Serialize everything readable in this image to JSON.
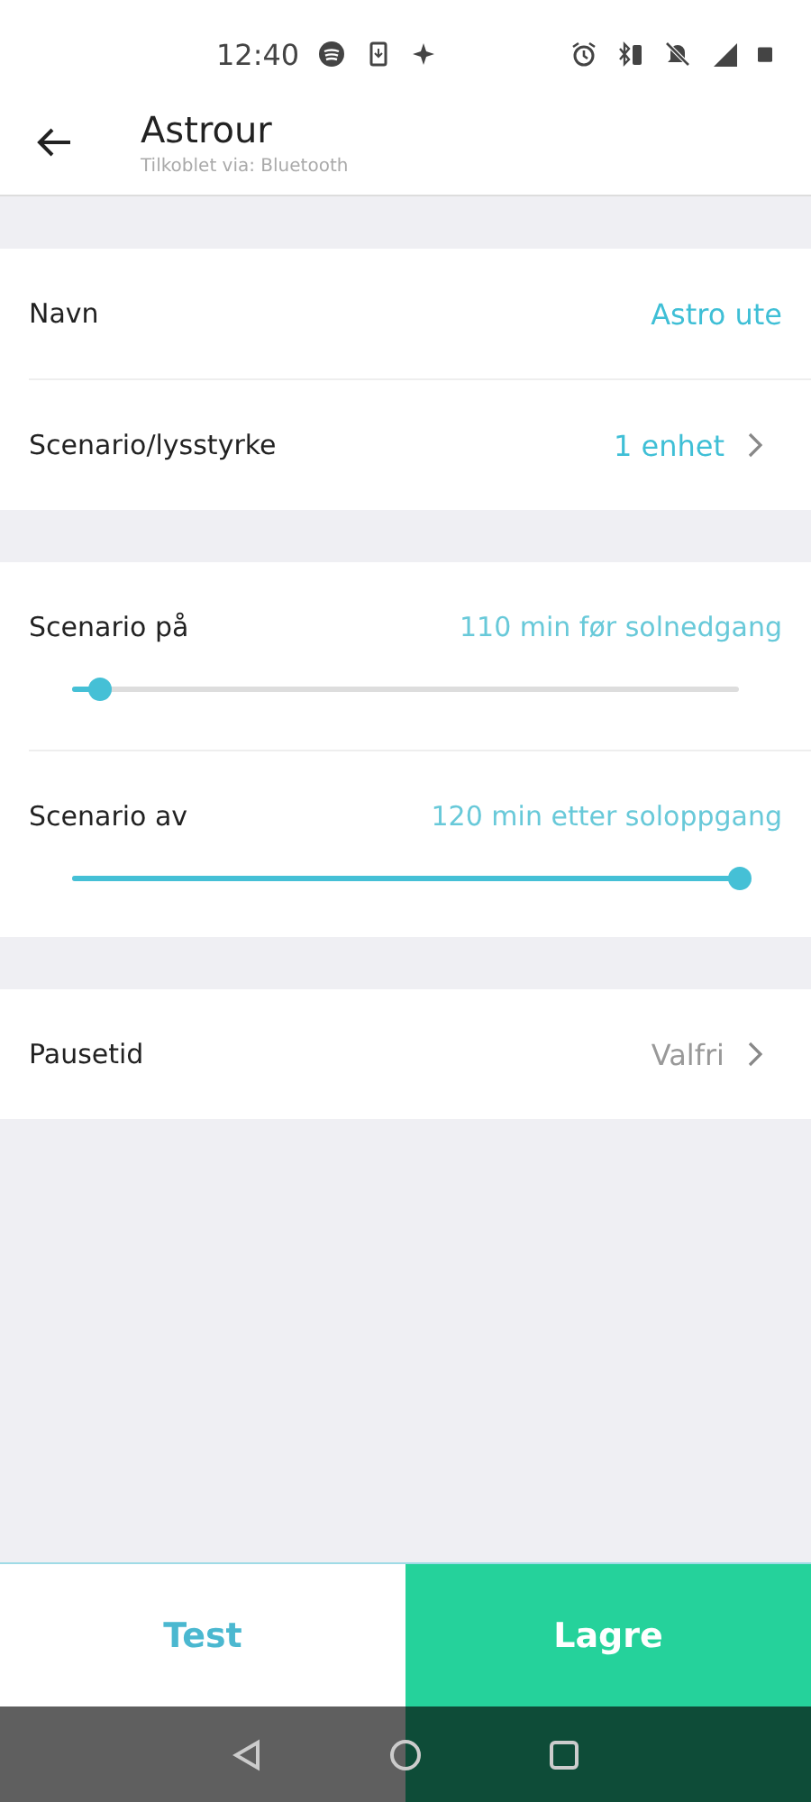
{
  "status_bar": {
    "time": "12:40"
  },
  "header": {
    "title": "Astrour",
    "subtitle": "Tilkoblet via: Bluetooth"
  },
  "sections": [
    {
      "rows": [
        {
          "kind": "value",
          "label": "Navn",
          "value": "Astro ute",
          "chevron": false,
          "muted": false
        },
        {
          "kind": "value",
          "label": "Scenario/lysstyrke",
          "value": "1 enhet",
          "chevron": true,
          "muted": false
        }
      ]
    },
    {
      "rows": [
        {
          "kind": "slider",
          "label": "Scenario på",
          "value": "110 min før solnedgang",
          "level": 0.04
        },
        {
          "kind": "slider",
          "label": "Scenario av",
          "value": "120 min etter soloppgang",
          "level": 1.0
        }
      ]
    },
    {
      "rows": [
        {
          "kind": "value",
          "label": "Pausetid",
          "value": "Valfri",
          "chevron": true,
          "muted": true
        }
      ]
    }
  ],
  "buttons": [
    {
      "label": "Test",
      "primary": false
    },
    {
      "label": "Lagre",
      "primary": true
    }
  ]
}
